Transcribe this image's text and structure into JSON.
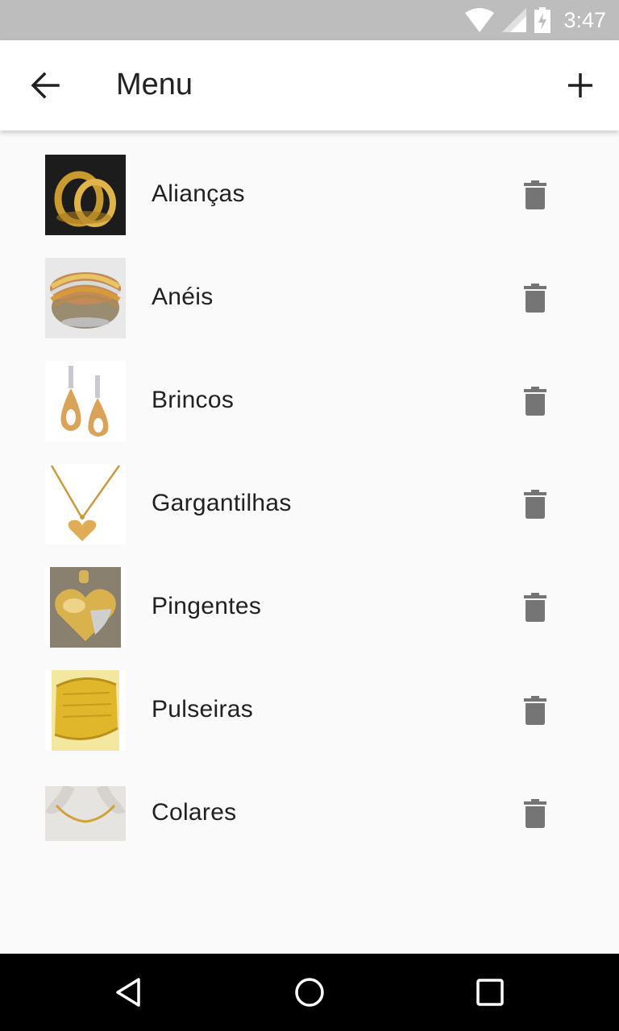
{
  "status_bar": {
    "time": "3:47",
    "icons": [
      "wifi-icon",
      "signal-icon",
      "battery-charging-icon"
    ]
  },
  "app_bar": {
    "title": "Menu",
    "back_icon": "arrow-left-icon",
    "add_icon": "plus-icon"
  },
  "list": {
    "items": [
      {
        "label": "Alianças",
        "image": "rings-pair-photo"
      },
      {
        "label": "Anéis",
        "image": "multi-tone-ring-photo"
      },
      {
        "label": "Brincos",
        "image": "drop-earrings-photo"
      },
      {
        "label": "Gargantilhas",
        "image": "heart-necklace-photo"
      },
      {
        "label": "Pingentes",
        "image": "heart-pendant-photo"
      },
      {
        "label": "Pulseiras",
        "image": "gold-bracelet-photo"
      },
      {
        "label": "Colares",
        "image": "gold-chain-photo"
      }
    ],
    "delete_icon": "trash-icon"
  },
  "nav_bar": {
    "icons": [
      "back-triangle-icon",
      "home-circle-icon",
      "recents-square-icon"
    ]
  },
  "colors": {
    "status_bar": "#bdbdbd",
    "app_bar": "#ffffff",
    "background": "#fafafa",
    "text": "#212121",
    "icon_gray": "#757575",
    "nav_bar": "#000000",
    "gold": "#d4a53a"
  }
}
